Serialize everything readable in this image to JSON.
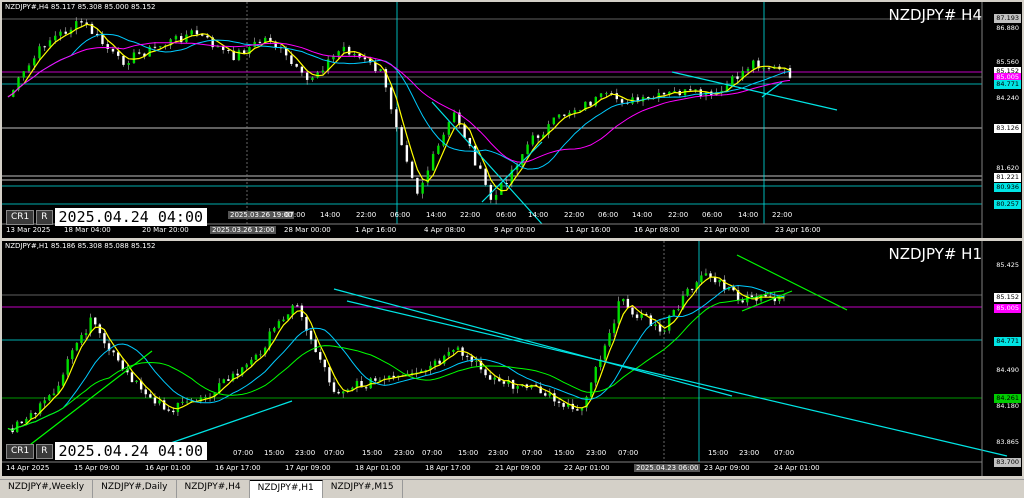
{
  "charts": {
    "h4": {
      "header": "NZDJPY#,H4  85.117 85.308 85.000 85.152",
      "symbol": "NZDJPY# H4",
      "cr": "CR1",
      "r": "R",
      "datetime": "2025.04.24 04:00",
      "prices": [
        {
          "text": "87.193",
          "color": "#c0c0c0",
          "fg": "#000"
        },
        {
          "text": "86.880",
          "color": "transparent",
          "fg": "#fff"
        },
        {
          "text": "85.560",
          "color": "transparent",
          "fg": "#fff"
        },
        {
          "text": "85.152",
          "color": "#ffffff",
          "fg": "#000"
        },
        {
          "text": "85.005",
          "color": "#ff00ff",
          "fg": "#fff"
        },
        {
          "text": "84.771",
          "color": "#00e5e5",
          "fg": "#000"
        },
        {
          "text": "84.240",
          "color": "transparent",
          "fg": "#fff"
        },
        {
          "text": "83.126",
          "color": "#ffffff",
          "fg": "#000"
        },
        {
          "text": "81.620",
          "color": "transparent",
          "fg": "#fff"
        },
        {
          "text": "81.221",
          "color": "#ffffff",
          "fg": "#000"
        },
        {
          "text": "80.936",
          "color": "#00e5e5",
          "fg": "#000"
        },
        {
          "text": "80.257",
          "color": "#00e5e5",
          "fg": "#000"
        }
      ],
      "time_labels": [
        "13 Mar 2025",
        "18 Mar 04:00",
        "20 Mar 20:00",
        "2025.03.26 12:00",
        "28 Mar 00:00",
        "1 Apr 16:00",
        "4 Apr 08:00",
        "9 Apr 00:00",
        "11 Apr 16:00",
        "16 Apr 08:00",
        "21 Apr 00:00",
        "23 Apr 16:00"
      ],
      "grid_times": [
        "2025.03.26 19:00",
        "07:00",
        "14:00",
        "22:00",
        "06:00",
        "14:00",
        "22:00",
        "06:00",
        "14:00",
        "22:00",
        "06:00",
        "14:00",
        "22:00",
        "06:00",
        "14:00",
        "22:00"
      ]
    },
    "h1": {
      "header": "NZDJPY#,H1  85.186 85.308 85.088 85.152",
      "symbol": "NZDJPY# H1",
      "cr": "CR1",
      "r": "R",
      "datetime": "2025.04.24 04:00",
      "prices": [
        {
          "text": "85.425",
          "color": "transparent",
          "fg": "#fff"
        },
        {
          "text": "85.152",
          "color": "#ffffff",
          "fg": "#000"
        },
        {
          "text": "85.005",
          "color": "#ff00ff",
          "fg": "#fff"
        },
        {
          "text": "84.771",
          "color": "#00e5e5",
          "fg": "#000"
        },
        {
          "text": "84.490",
          "color": "transparent",
          "fg": "#fff"
        },
        {
          "text": "84.261",
          "color": "#00cc00",
          "fg": "#000"
        },
        {
          "text": "84.180",
          "color": "transparent",
          "fg": "#fff"
        },
        {
          "text": "83.865",
          "color": "transparent",
          "fg": "#fff"
        },
        {
          "text": "83.700",
          "color": "#c0c0c0",
          "fg": "#000"
        }
      ],
      "time_labels": [
        "14 Apr 2025",
        "15 Apr 09:00",
        "16 Apr 01:00",
        "16 Apr 17:00",
        "17 Apr 09:00",
        "18 Apr 01:00",
        "18 Apr 17:00",
        "21 Apr 09:00",
        "22 Apr 01:00",
        "2025.04.23 06:00",
        "23 Apr 09:00",
        "24 Apr 01:00"
      ],
      "grid_times": [
        "07:00",
        "15:00",
        "23:00",
        "07:00",
        "15:00",
        "23:00",
        "07:00",
        "15:00",
        "23:00",
        "07:00",
        "15:00",
        "23:00",
        "07:00",
        "15:00",
        "23:00",
        "07:00"
      ]
    }
  },
  "tabs": [
    {
      "label": "NZDJPY#,Weekly",
      "active": false
    },
    {
      "label": "NZDJPY#,Daily",
      "active": false
    },
    {
      "label": "NZDJPY#,H4",
      "active": false
    },
    {
      "label": "NZDJPY#,H1",
      "active": true
    },
    {
      "label": "NZDJPY#,M15",
      "active": false
    }
  ],
  "colors": {
    "background": "#000000",
    "price_line": "#ffff00",
    "ma_fast": "#00ccff",
    "ma_slow": "#ff00ff",
    "ma_mid": "#00ff00",
    "trend": "#00e5e5"
  }
}
